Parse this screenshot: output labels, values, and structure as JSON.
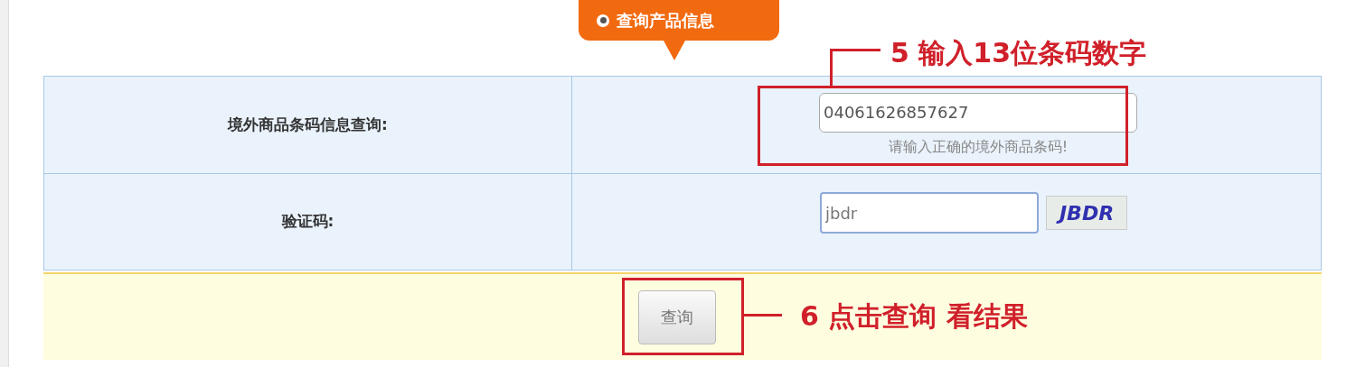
{
  "query_tab": {
    "label": "查询产品信息",
    "selected": true
  },
  "form": {
    "rows": [
      {
        "kind": "barcode",
        "label": "境外商品条码信息查询:",
        "value": "04061626857627",
        "hint": "请输入正确的境外商品条码!"
      },
      {
        "kind": "captcha",
        "label": "验证码:",
        "value": "jbdr",
        "captcha": "JBDR"
      }
    ],
    "submit": "查询"
  },
  "annotations": [
    {
      "text": "5 输入13位条码数字"
    },
    {
      "text": "6 点击查询 看结果"
    }
  ]
}
